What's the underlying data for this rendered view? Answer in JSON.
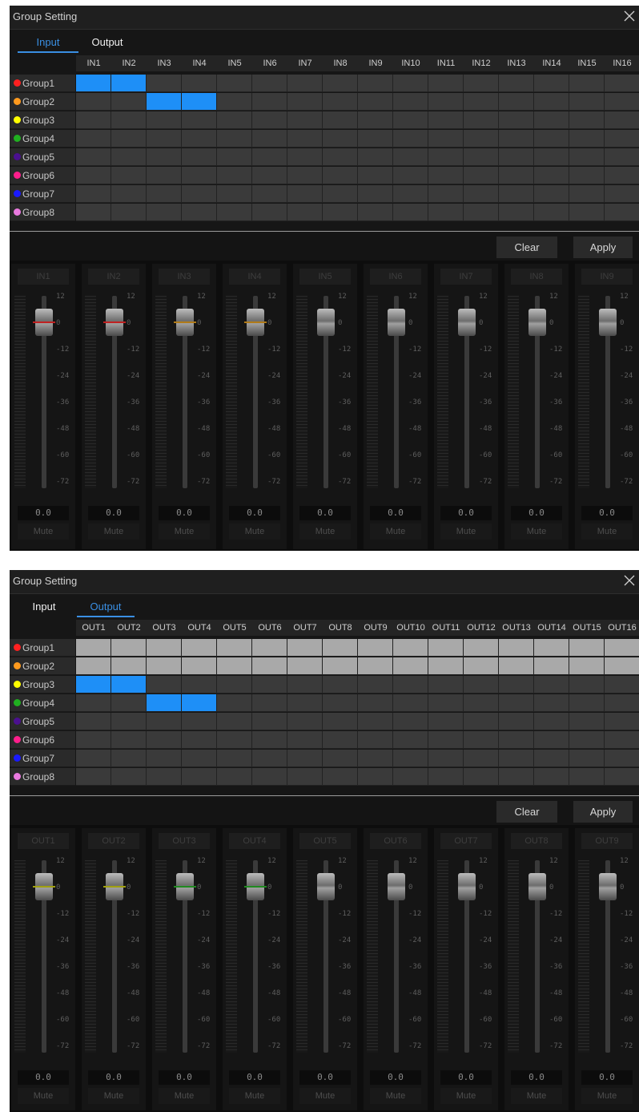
{
  "panels": [
    {
      "id": "input",
      "title": "Group Setting",
      "tabs": [
        "Input",
        "Output"
      ],
      "active_tab": 0,
      "columns": [
        "IN1",
        "IN2",
        "IN3",
        "IN4",
        "IN5",
        "IN6",
        "IN7",
        "IN8",
        "IN9",
        "IN10",
        "IN11",
        "IN12",
        "IN13",
        "IN14",
        "IN15",
        "IN16"
      ],
      "groups": [
        {
          "label": "Group1",
          "color": "#ff2020"
        },
        {
          "label": "Group2",
          "color": "#ff9a1e"
        },
        {
          "label": "Group3",
          "color": "#ffff00"
        },
        {
          "label": "Group4",
          "color": "#20b020"
        },
        {
          "label": "Group5",
          "color": "#4b1090"
        },
        {
          "label": "Group6",
          "color": "#ff1e8c"
        },
        {
          "label": "Group7",
          "color": "#1a1aff"
        },
        {
          "label": "Group8",
          "color": "#ea7ae0"
        }
      ],
      "selected_cells": [
        [
          0,
          0
        ],
        [
          0,
          1
        ],
        [
          1,
          2
        ],
        [
          1,
          3
        ]
      ],
      "disabled_rows": [],
      "buttons": {
        "clear": "Clear",
        "apply": "Apply"
      },
      "channels": [
        {
          "label": "IN1",
          "gain": "0.0",
          "mute": "Mute",
          "group_color": "#c02020"
        },
        {
          "label": "IN2",
          "gain": "0.0",
          "mute": "Mute",
          "group_color": "#c02020"
        },
        {
          "label": "IN3",
          "gain": "0.0",
          "mute": "Mute",
          "group_color": "#b07a18"
        },
        {
          "label": "IN4",
          "gain": "0.0",
          "mute": "Mute",
          "group_color": "#b07a18"
        },
        {
          "label": "IN5",
          "gain": "0.0",
          "mute": "Mute",
          "group_color": ""
        },
        {
          "label": "IN6",
          "gain": "0.0",
          "mute": "Mute",
          "group_color": ""
        },
        {
          "label": "IN7",
          "gain": "0.0",
          "mute": "Mute",
          "group_color": ""
        },
        {
          "label": "IN8",
          "gain": "0.0",
          "mute": "Mute",
          "group_color": ""
        },
        {
          "label": "IN9",
          "gain": "0.0",
          "mute": "Mute",
          "group_color": ""
        }
      ],
      "scale": [
        "12",
        "0",
        "-12",
        "-24",
        "-36",
        "-48",
        "-60",
        "-72"
      ]
    },
    {
      "id": "output",
      "title": "Group Setting",
      "tabs": [
        "Input",
        "Output"
      ],
      "active_tab": 1,
      "columns": [
        "OUT1",
        "OUT2",
        "OUT3",
        "OUT4",
        "OUT5",
        "OUT6",
        "OUT7",
        "OUT8",
        "OUT9",
        "OUT10",
        "OUT11",
        "OUT12",
        "OUT13",
        "OUT14",
        "OUT15",
        "OUT16"
      ],
      "groups": [
        {
          "label": "Group1",
          "color": "#ff2020"
        },
        {
          "label": "Group2",
          "color": "#ff9a1e"
        },
        {
          "label": "Group3",
          "color": "#ffff00"
        },
        {
          "label": "Group4",
          "color": "#20b020"
        },
        {
          "label": "Group5",
          "color": "#4b1090"
        },
        {
          "label": "Group6",
          "color": "#ff1e8c"
        },
        {
          "label": "Group7",
          "color": "#1a1aff"
        },
        {
          "label": "Group8",
          "color": "#ea7ae0"
        }
      ],
      "selected_cells": [
        [
          2,
          0
        ],
        [
          2,
          1
        ],
        [
          3,
          2
        ],
        [
          3,
          3
        ]
      ],
      "disabled_rows": [
        0,
        1
      ],
      "buttons": {
        "clear": "Clear",
        "apply": "Apply"
      },
      "channels": [
        {
          "label": "OUT1",
          "gain": "0.0",
          "mute": "Mute",
          "group_color": "#a0a010"
        },
        {
          "label": "OUT2",
          "gain": "0.0",
          "mute": "Mute",
          "group_color": "#a0a010"
        },
        {
          "label": "OUT3",
          "gain": "0.0",
          "mute": "Mute",
          "group_color": "#208a20"
        },
        {
          "label": "OUT4",
          "gain": "0.0",
          "mute": "Mute",
          "group_color": "#208a20"
        },
        {
          "label": "OUT5",
          "gain": "0.0",
          "mute": "Mute",
          "group_color": ""
        },
        {
          "label": "OUT6",
          "gain": "0.0",
          "mute": "Mute",
          "group_color": ""
        },
        {
          "label": "OUT7",
          "gain": "0.0",
          "mute": "Mute",
          "group_color": ""
        },
        {
          "label": "OUT8",
          "gain": "0.0",
          "mute": "Mute",
          "group_color": ""
        },
        {
          "label": "OUT9",
          "gain": "0.0",
          "mute": "Mute",
          "group_color": ""
        }
      ],
      "scale": [
        "12",
        "0",
        "-12",
        "-24",
        "-36",
        "-48",
        "-60",
        "-72"
      ]
    }
  ]
}
